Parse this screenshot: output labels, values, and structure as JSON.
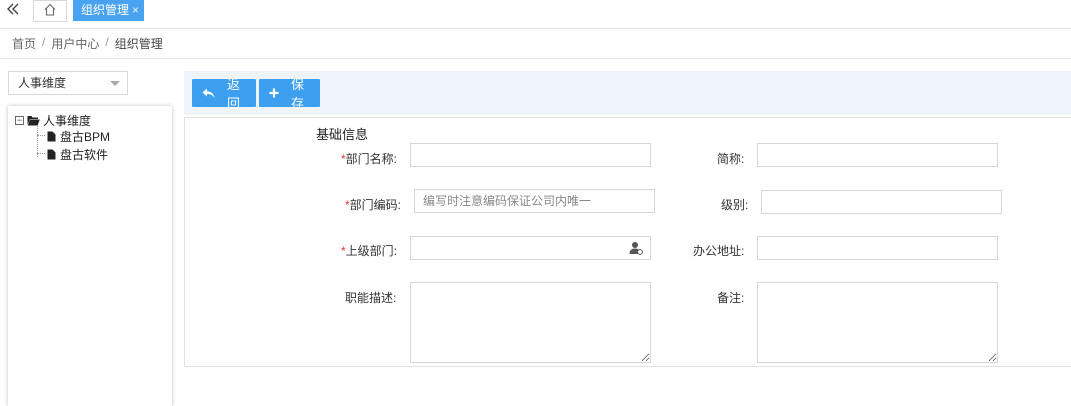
{
  "tabs": {
    "collapse_icon": "double-chevron-left-icon",
    "home_icon": "home-icon",
    "active_label": "组织管理",
    "close_glyph": "×"
  },
  "breadcrumb": [
    "首页",
    "用户中心",
    "组织管理"
  ],
  "breadcrumb_separator": "/",
  "dimension_select": {
    "value": "人事维度"
  },
  "tree": {
    "root": {
      "label": "人事维度",
      "expanded": true
    },
    "children": [
      {
        "label": "盘古BPM"
      },
      {
        "label": "盘古软件"
      }
    ]
  },
  "toolbar": {
    "back_label": "返回",
    "save_label": "保存"
  },
  "form": {
    "section_title": "基础信息",
    "required_mark": "*",
    "fields": {
      "dept_name": {
        "label": "部门名称:",
        "value": ""
      },
      "short_name": {
        "label": "简称:",
        "value": ""
      },
      "dept_code": {
        "label": "部门编码:",
        "placeholder": "编写时注意编码保证公司内唯一"
      },
      "level": {
        "label": "级别:",
        "value": ""
      },
      "parent_dept": {
        "label": "上级部门:",
        "value": ""
      },
      "office_address": {
        "label": "办公地址:",
        "value": ""
      },
      "function_desc": {
        "label": "职能描述:",
        "value": ""
      },
      "remark": {
        "label": "备注:",
        "value": ""
      }
    }
  },
  "colors": {
    "accent": "#3c9ff0",
    "tab_active": "#4aa3f0",
    "toolbar_bg": "#eef4f9",
    "required": "#ee3333"
  }
}
